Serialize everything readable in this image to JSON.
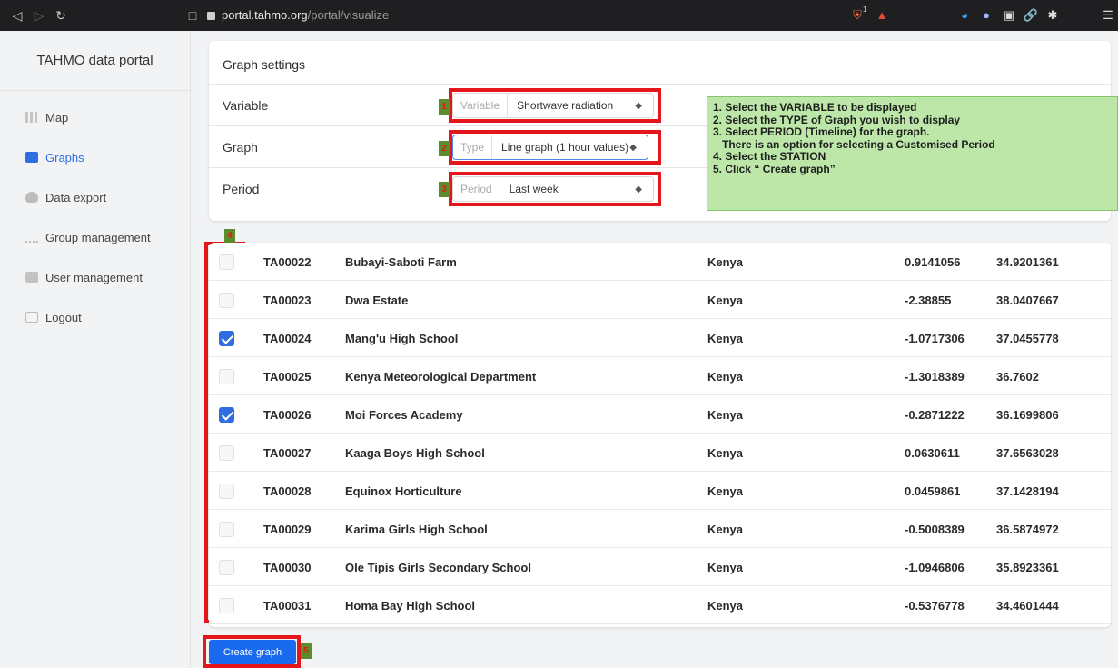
{
  "browser": {
    "url_host": "portal.tahmo.org",
    "url_path": "/portal/visualize",
    "badge_count": "1"
  },
  "sidebar": {
    "brand": "TAHMO data portal",
    "items": [
      {
        "label": "Map",
        "icon": "map-icon"
      },
      {
        "label": "Graphs",
        "icon": "chart-icon",
        "active": true
      },
      {
        "label": "Data export",
        "icon": "cloud-icon"
      },
      {
        "label": "Group management",
        "icon": "group-icon"
      },
      {
        "label": "User management",
        "icon": "user-icon"
      },
      {
        "label": "Logout",
        "icon": "logout-icon"
      }
    ]
  },
  "settings": {
    "title": "Graph settings",
    "variable": {
      "label": "Variable",
      "prefix": "Variable",
      "value": "Shortwave radiation"
    },
    "graph": {
      "label": "Graph",
      "prefix": "Type",
      "value": "Line graph (1 hour values)"
    },
    "period": {
      "label": "Period",
      "prefix": "Period",
      "value": "Last week"
    }
  },
  "annotations": {
    "markers": [
      "1",
      "2",
      "3",
      "4",
      "5"
    ],
    "note_lines": [
      "1. Select the VARIABLE to be displayed",
      "2. Select the TYPE of Graph you wish to display",
      "3. Select PERIOD (Timeline) for the graph.",
      "   There is an option for selecting a Customised Period",
      "4. Select the STATION",
      "5. Click “ Create graph”"
    ],
    "highlight_color": "#e3171b",
    "note_color": "#bce7a8"
  },
  "stations": [
    {
      "id": "TA00022",
      "name": "Bubayi-Saboti Farm",
      "country": "Kenya",
      "lat": "0.9141056",
      "lon": "34.9201361",
      "checked": false
    },
    {
      "id": "TA00023",
      "name": "Dwa Estate",
      "country": "Kenya",
      "lat": "-2.38855",
      "lon": "38.0407667",
      "checked": false
    },
    {
      "id": "TA00024",
      "name": "Mang'u High School",
      "country": "Kenya",
      "lat": "-1.0717306",
      "lon": "37.0455778",
      "checked": true
    },
    {
      "id": "TA00025",
      "name": "Kenya Meteorological Department",
      "country": "Kenya",
      "lat": "-1.3018389",
      "lon": "36.7602",
      "checked": false
    },
    {
      "id": "TA00026",
      "name": "Moi Forces Academy",
      "country": "Kenya",
      "lat": "-0.2871222",
      "lon": "36.1699806",
      "checked": true
    },
    {
      "id": "TA00027",
      "name": "Kaaga Boys High School",
      "country": "Kenya",
      "lat": "0.0630611",
      "lon": "37.6563028",
      "checked": false
    },
    {
      "id": "TA00028",
      "name": "Equinox Horticulture",
      "country": "Kenya",
      "lat": "0.0459861",
      "lon": "37.1428194",
      "checked": false
    },
    {
      "id": "TA00029",
      "name": "Karima Girls High School",
      "country": "Kenya",
      "lat": "-0.5008389",
      "lon": "36.5874972",
      "checked": false
    },
    {
      "id": "TA00030",
      "name": "Ole Tipis Girls Secondary School",
      "country": "Kenya",
      "lat": "-1.0946806",
      "lon": "35.8923361",
      "checked": false
    },
    {
      "id": "TA00031",
      "name": "Homa Bay High School",
      "country": "Kenya",
      "lat": "-0.5376778",
      "lon": "34.4601444",
      "checked": false
    }
  ],
  "actions": {
    "create_label": "Create graph"
  },
  "theme": {
    "accent": "#2f6de1",
    "button": "#1a6af0"
  }
}
